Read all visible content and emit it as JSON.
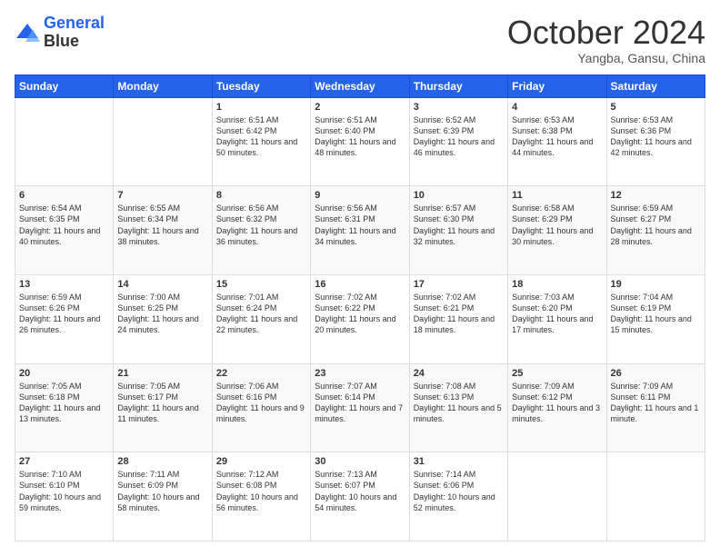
{
  "logo": {
    "line1": "General",
    "line2": "Blue"
  },
  "header": {
    "title": "October 2024",
    "subtitle": "Yangba, Gansu, China"
  },
  "weekdays": [
    "Sunday",
    "Monday",
    "Tuesday",
    "Wednesday",
    "Thursday",
    "Friday",
    "Saturday"
  ],
  "weeks": [
    [
      {
        "day": "",
        "sunrise": "",
        "sunset": "",
        "daylight": ""
      },
      {
        "day": "",
        "sunrise": "",
        "sunset": "",
        "daylight": ""
      },
      {
        "day": "1",
        "sunrise": "Sunrise: 6:51 AM",
        "sunset": "Sunset: 6:42 PM",
        "daylight": "Daylight: 11 hours and 50 minutes."
      },
      {
        "day": "2",
        "sunrise": "Sunrise: 6:51 AM",
        "sunset": "Sunset: 6:40 PM",
        "daylight": "Daylight: 11 hours and 48 minutes."
      },
      {
        "day": "3",
        "sunrise": "Sunrise: 6:52 AM",
        "sunset": "Sunset: 6:39 PM",
        "daylight": "Daylight: 11 hours and 46 minutes."
      },
      {
        "day": "4",
        "sunrise": "Sunrise: 6:53 AM",
        "sunset": "Sunset: 6:38 PM",
        "daylight": "Daylight: 11 hours and 44 minutes."
      },
      {
        "day": "5",
        "sunrise": "Sunrise: 6:53 AM",
        "sunset": "Sunset: 6:36 PM",
        "daylight": "Daylight: 11 hours and 42 minutes."
      }
    ],
    [
      {
        "day": "6",
        "sunrise": "Sunrise: 6:54 AM",
        "sunset": "Sunset: 6:35 PM",
        "daylight": "Daylight: 11 hours and 40 minutes."
      },
      {
        "day": "7",
        "sunrise": "Sunrise: 6:55 AM",
        "sunset": "Sunset: 6:34 PM",
        "daylight": "Daylight: 11 hours and 38 minutes."
      },
      {
        "day": "8",
        "sunrise": "Sunrise: 6:56 AM",
        "sunset": "Sunset: 6:32 PM",
        "daylight": "Daylight: 11 hours and 36 minutes."
      },
      {
        "day": "9",
        "sunrise": "Sunrise: 6:56 AM",
        "sunset": "Sunset: 6:31 PM",
        "daylight": "Daylight: 11 hours and 34 minutes."
      },
      {
        "day": "10",
        "sunrise": "Sunrise: 6:57 AM",
        "sunset": "Sunset: 6:30 PM",
        "daylight": "Daylight: 11 hours and 32 minutes."
      },
      {
        "day": "11",
        "sunrise": "Sunrise: 6:58 AM",
        "sunset": "Sunset: 6:29 PM",
        "daylight": "Daylight: 11 hours and 30 minutes."
      },
      {
        "day": "12",
        "sunrise": "Sunrise: 6:59 AM",
        "sunset": "Sunset: 6:27 PM",
        "daylight": "Daylight: 11 hours and 28 minutes."
      }
    ],
    [
      {
        "day": "13",
        "sunrise": "Sunrise: 6:59 AM",
        "sunset": "Sunset: 6:26 PM",
        "daylight": "Daylight: 11 hours and 26 minutes."
      },
      {
        "day": "14",
        "sunrise": "Sunrise: 7:00 AM",
        "sunset": "Sunset: 6:25 PM",
        "daylight": "Daylight: 11 hours and 24 minutes."
      },
      {
        "day": "15",
        "sunrise": "Sunrise: 7:01 AM",
        "sunset": "Sunset: 6:24 PM",
        "daylight": "Daylight: 11 hours and 22 minutes."
      },
      {
        "day": "16",
        "sunrise": "Sunrise: 7:02 AM",
        "sunset": "Sunset: 6:22 PM",
        "daylight": "Daylight: 11 hours and 20 minutes."
      },
      {
        "day": "17",
        "sunrise": "Sunrise: 7:02 AM",
        "sunset": "Sunset: 6:21 PM",
        "daylight": "Daylight: 11 hours and 18 minutes."
      },
      {
        "day": "18",
        "sunrise": "Sunrise: 7:03 AM",
        "sunset": "Sunset: 6:20 PM",
        "daylight": "Daylight: 11 hours and 17 minutes."
      },
      {
        "day": "19",
        "sunrise": "Sunrise: 7:04 AM",
        "sunset": "Sunset: 6:19 PM",
        "daylight": "Daylight: 11 hours and 15 minutes."
      }
    ],
    [
      {
        "day": "20",
        "sunrise": "Sunrise: 7:05 AM",
        "sunset": "Sunset: 6:18 PM",
        "daylight": "Daylight: 11 hours and 13 minutes."
      },
      {
        "day": "21",
        "sunrise": "Sunrise: 7:05 AM",
        "sunset": "Sunset: 6:17 PM",
        "daylight": "Daylight: 11 hours and 11 minutes."
      },
      {
        "day": "22",
        "sunrise": "Sunrise: 7:06 AM",
        "sunset": "Sunset: 6:16 PM",
        "daylight": "Daylight: 11 hours and 9 minutes."
      },
      {
        "day": "23",
        "sunrise": "Sunrise: 7:07 AM",
        "sunset": "Sunset: 6:14 PM",
        "daylight": "Daylight: 11 hours and 7 minutes."
      },
      {
        "day": "24",
        "sunrise": "Sunrise: 7:08 AM",
        "sunset": "Sunset: 6:13 PM",
        "daylight": "Daylight: 11 hours and 5 minutes."
      },
      {
        "day": "25",
        "sunrise": "Sunrise: 7:09 AM",
        "sunset": "Sunset: 6:12 PM",
        "daylight": "Daylight: 11 hours and 3 minutes."
      },
      {
        "day": "26",
        "sunrise": "Sunrise: 7:09 AM",
        "sunset": "Sunset: 6:11 PM",
        "daylight": "Daylight: 11 hours and 1 minute."
      }
    ],
    [
      {
        "day": "27",
        "sunrise": "Sunrise: 7:10 AM",
        "sunset": "Sunset: 6:10 PM",
        "daylight": "Daylight: 10 hours and 59 minutes."
      },
      {
        "day": "28",
        "sunrise": "Sunrise: 7:11 AM",
        "sunset": "Sunset: 6:09 PM",
        "daylight": "Daylight: 10 hours and 58 minutes."
      },
      {
        "day": "29",
        "sunrise": "Sunrise: 7:12 AM",
        "sunset": "Sunset: 6:08 PM",
        "daylight": "Daylight: 10 hours and 56 minutes."
      },
      {
        "day": "30",
        "sunrise": "Sunrise: 7:13 AM",
        "sunset": "Sunset: 6:07 PM",
        "daylight": "Daylight: 10 hours and 54 minutes."
      },
      {
        "day": "31",
        "sunrise": "Sunrise: 7:14 AM",
        "sunset": "Sunset: 6:06 PM",
        "daylight": "Daylight: 10 hours and 52 minutes."
      },
      {
        "day": "",
        "sunrise": "",
        "sunset": "",
        "daylight": ""
      },
      {
        "day": "",
        "sunrise": "",
        "sunset": "",
        "daylight": ""
      }
    ]
  ]
}
